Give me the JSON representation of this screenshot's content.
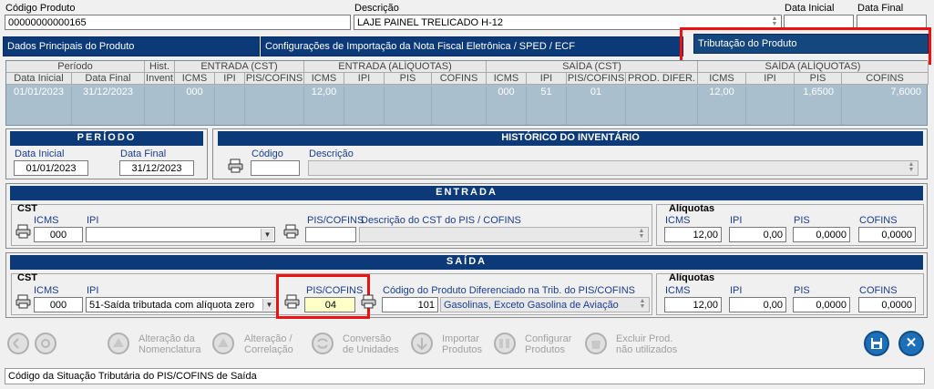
{
  "header": {
    "codigo_label": "Código Produto",
    "codigo_value": "00000000000165",
    "descricao_label": "Descrição",
    "descricao_value": "LAJE PAINEL TRELICADO H-12",
    "data_inicial_label": "Data Inicial",
    "data_final_label": "Data Final"
  },
  "tabs": [
    {
      "label": "Dados Principais do Produto"
    },
    {
      "label": "Configurações de Importação da Nota Fiscal Eletrônica / SPED / ECF"
    },
    {
      "label": "Tributação do Produto"
    }
  ],
  "grid": {
    "groups": [
      "Período",
      "Hist.",
      "ENTRADA (CST)",
      "ENTRADA (ALÍQUOTAS)",
      "SAÍDA (CST)",
      "SAÍDA (ALÍQUOTAS)"
    ],
    "columns": [
      "Data Inicial",
      "Data Final",
      "Invent",
      "ICMS",
      "IPI",
      "PIS/COFINS",
      "ICMS",
      "IPI",
      "PIS",
      "COFINS",
      "ICMS",
      "IPI",
      "PIS/COFINS",
      "PROD. DIFER.",
      "ICMS",
      "IPI",
      "PIS",
      "COFINS"
    ],
    "row": [
      "01/01/2023",
      "31/12/2023",
      "",
      "000",
      "",
      "",
      "12,00",
      "",
      "",
      "",
      "000",
      "51",
      "01",
      "",
      "12,00",
      "",
      "1,6500",
      "7,6000"
    ]
  },
  "periodo": {
    "title": "PERÍODO",
    "data_inicial_label": "Data Inicial",
    "data_inicial_value": "01/01/2023",
    "data_final_label": "Data Final",
    "data_final_value": "31/12/2023"
  },
  "historico": {
    "title": "HISTÓRICO DO INVENTÁRIO",
    "codigo_label": "Código",
    "descricao_label": "Descrição"
  },
  "entrada": {
    "title": "ENTRADA",
    "cst_label": "CST",
    "icms_label": "ICMS",
    "icms_value": "000",
    "ipi_label": "IPI",
    "ipi_value": "",
    "piscofins_label": "PIS/COFINS",
    "piscofins_desc_label": "Descrição do CST do PIS / COFINS",
    "aliquotas_label": "Alíquotas",
    "aliq_icms_label": "ICMS",
    "aliq_icms_value": "12,00",
    "aliq_ipi_label": "IPI",
    "aliq_ipi_value": "0,00",
    "aliq_pis_label": "PIS",
    "aliq_pis_value": "0,0000",
    "aliq_cofins_label": "COFINS",
    "aliq_cofins_value": "0,0000"
  },
  "saida": {
    "title": "SAÍDA",
    "cst_label": "CST",
    "icms_label": "ICMS",
    "icms_value": "000",
    "ipi_label": "IPI",
    "ipi_value": "51-Saída tributada com alíquota zero",
    "piscofins_label": "PIS/COFINS",
    "piscofins_value": "04",
    "prod_dif_label": "Código do Produto Diferenciado na Trib. do PIS/COFINS",
    "prod_dif_code": "101",
    "prod_dif_desc": "Gasolinas, Exceto Gasolina de Aviação",
    "aliquotas_label": "Alíquotas",
    "aliq_icms_label": "ICMS",
    "aliq_icms_value": "12,00",
    "aliq_ipi_label": "IPI",
    "aliq_ipi_value": "0,00",
    "aliq_pis_label": "PIS",
    "aliq_pis_value": "0,0000",
    "aliq_cofins_label": "COFINS",
    "aliq_cofins_value": "0,0000"
  },
  "toolbar": {
    "alteracao_nomenclatura": [
      "Alteração da",
      "Nomenclatura"
    ],
    "alteracao_correlacao": [
      "Alteração /",
      "Correlação"
    ],
    "conversao_unidades": [
      "Conversão",
      "de Unidades"
    ],
    "importar_produtos": [
      "Importar",
      "Produtos"
    ],
    "configurar_produtos": [
      "Configurar",
      "Produtos"
    ],
    "excluir_produtos": [
      "Excluir Prod.",
      "não utilizados"
    ]
  },
  "status_text": "Código da Situação Tributária do PIS/COFINS de Saída",
  "colors": {
    "accent": "#0c3a78",
    "highlight": "#e11111",
    "grid_bg": "#a9bfcd"
  }
}
